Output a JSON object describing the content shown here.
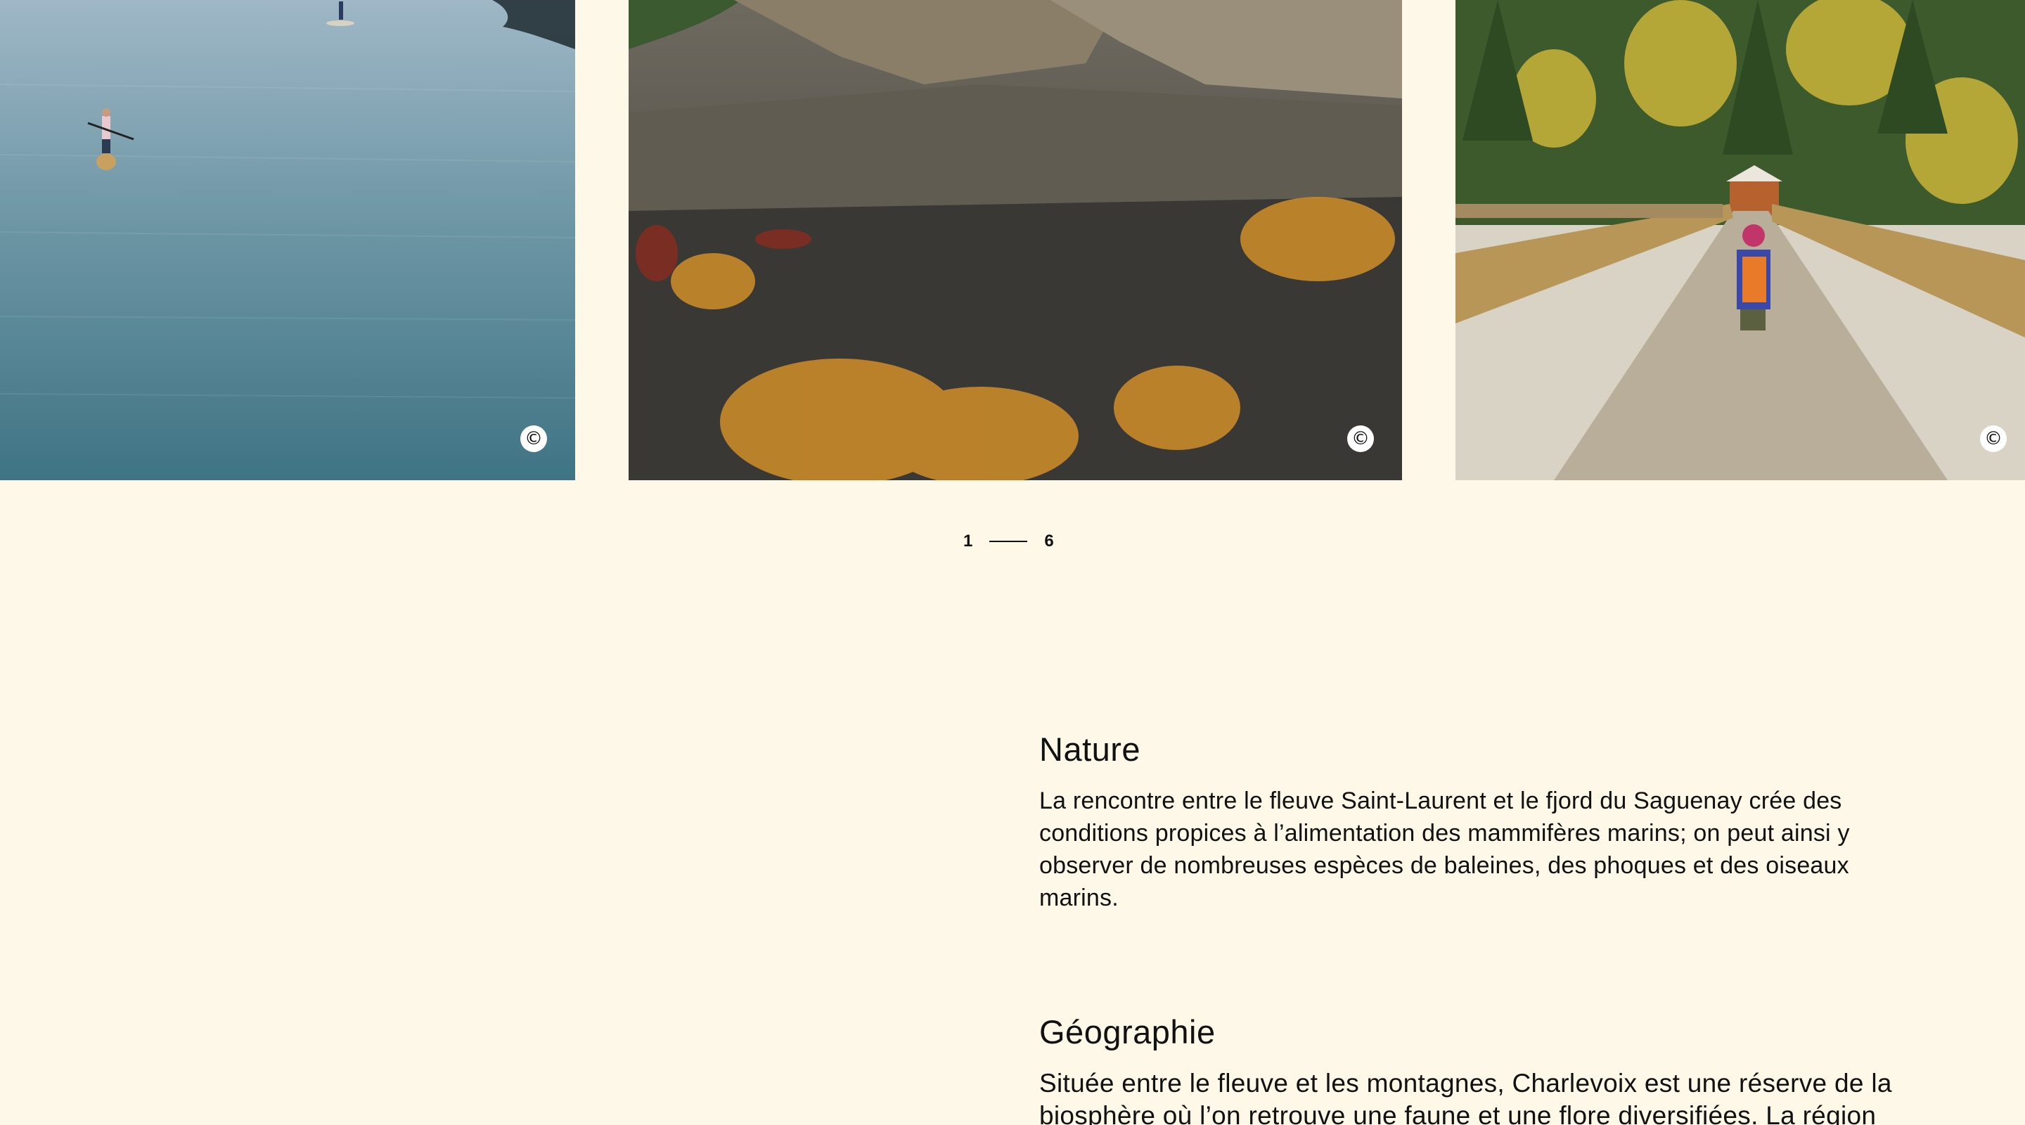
{
  "carousel": {
    "slides": [
      {
        "image": "paddleboarders-on-calm-water",
        "copyright_label": "©"
      },
      {
        "image": "rocky-mountain-summit-autumn",
        "copyright_label": "©"
      },
      {
        "image": "hiker-on-wooden-bridge-forest",
        "copyright_label": "©"
      }
    ],
    "pager": {
      "current": "1",
      "total": "6"
    }
  },
  "sections": {
    "nature": {
      "title": "Nature",
      "body": "La rencontre entre le fleuve Saint-Laurent et le fjord du Saguenay crée des conditions propices à l’alimentation des mammifères marins; on peut ainsi y observer de nombreuses espèces de baleines, des phoques et des oiseaux marins."
    },
    "geography": {
      "title": "Géographie",
      "body": "Située entre le fleuve et les montagnes, Charlevoix est une réserve de la biosphère où l’on retrouve une faune et une flore diversifiées. La région"
    }
  },
  "colors": {
    "background": "#fdf8e8",
    "text": "#111111"
  }
}
